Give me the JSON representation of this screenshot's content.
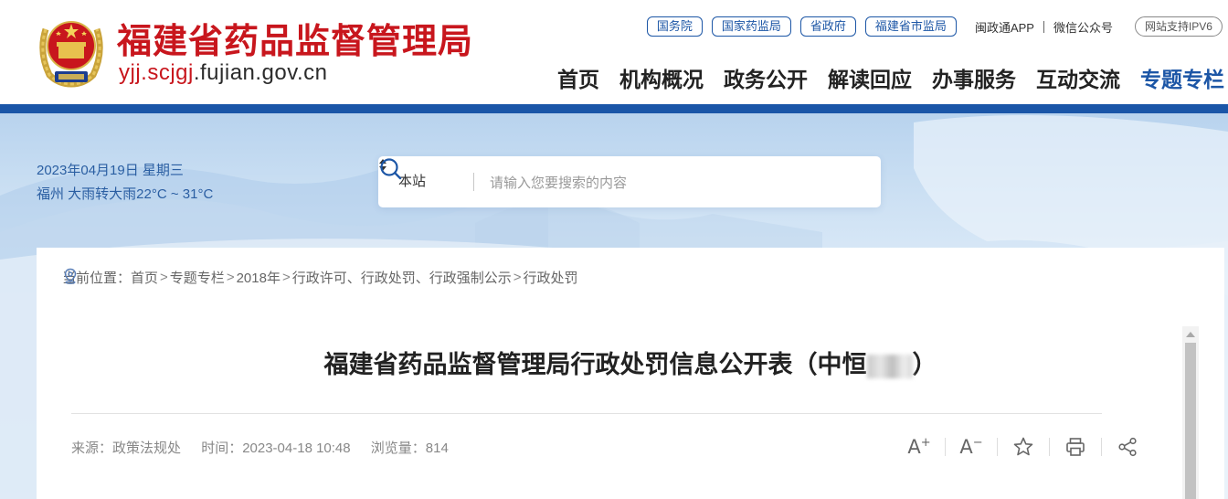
{
  "header": {
    "title": "福建省药品监督管理局",
    "domain_highlight": "yjj.scjgj",
    "domain_rest": ".fujian.gov.cn",
    "emblem_icon": "national-emblem-icon",
    "top_links": [
      "国务院",
      "国家药监局",
      "省政府",
      "福建省市监局"
    ],
    "plain_links": [
      "闽政通APP",
      "微信公众号"
    ],
    "ipv6_badge": "网站支持IPV6",
    "nav": [
      "首页",
      "机构概况",
      "政务公开",
      "解读回应",
      "办事服务",
      "互动交流",
      "专题专栏"
    ],
    "nav_active": "专题专栏"
  },
  "banner": {
    "date": "2023年04月19日 星期三",
    "weather": "福州 大雨转大雨22°C ~ 31°C"
  },
  "search": {
    "scope": "本站",
    "placeholder": "请输入您要搜索的内容",
    "icon": "search-icon"
  },
  "breadcrumb": {
    "label": "当前位置：",
    "items": [
      "首页",
      "专题专栏",
      "2018年",
      "行政许可、行政处罚、行政强制公示",
      "行政处罚"
    ]
  },
  "article": {
    "title_prefix": "福建省药品监督管理局行政处罚信息公开表（中恒",
    "title_suffix": "）",
    "source": "来源：政策法规处",
    "time": "时间：2023-04-18 10:48",
    "views": "浏览量：814"
  },
  "tools": {
    "font_increase": "A",
    "font_decrease": "A",
    "icons": [
      "font-increase-icon",
      "font-decrease-icon",
      "favorite-icon",
      "print-icon",
      "share-icon"
    ]
  },
  "colors": {
    "brand_red": "#c8161d",
    "brand_blue": "#1c56a6",
    "banner_text": "#2a5ea2"
  }
}
